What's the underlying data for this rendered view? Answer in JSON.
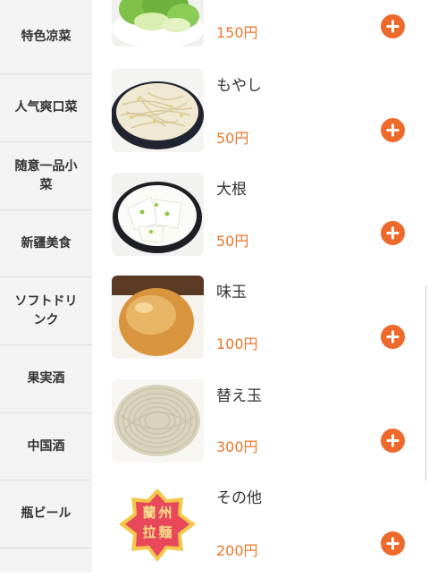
{
  "sidebar": {
    "categories": [
      {
        "label": "特色凉菜"
      },
      {
        "label": "人气爽口菜"
      },
      {
        "label": "随意一品小菜"
      },
      {
        "label": "新疆美食"
      },
      {
        "label": "ソフトドリンク"
      },
      {
        "label": "果実酒"
      },
      {
        "label": "中国酒"
      },
      {
        "label": "瓶ビール"
      }
    ]
  },
  "menu": {
    "items": [
      {
        "name": "",
        "price": "150円",
        "image": "bok-choy-plate"
      },
      {
        "name": "もやし",
        "price": "50円",
        "image": "bean-sprouts-plate"
      },
      {
        "name": "大根",
        "price": "50円",
        "image": "daikon-plate"
      },
      {
        "name": "味玉",
        "price": "100円",
        "image": "seasoned-egg"
      },
      {
        "name": "替え玉",
        "price": "300円",
        "image": "noodle-nest"
      },
      {
        "name": "その他",
        "price": "200円",
        "image": "lanzhou-lamian-logo",
        "logo_text": "蘭州拉麺"
      }
    ],
    "add_icon": "plus-circle-icon"
  },
  "colors": {
    "accent": "#ee6a2b",
    "price": "#e8772e",
    "sidebar_bg": "#f3f3f3"
  }
}
